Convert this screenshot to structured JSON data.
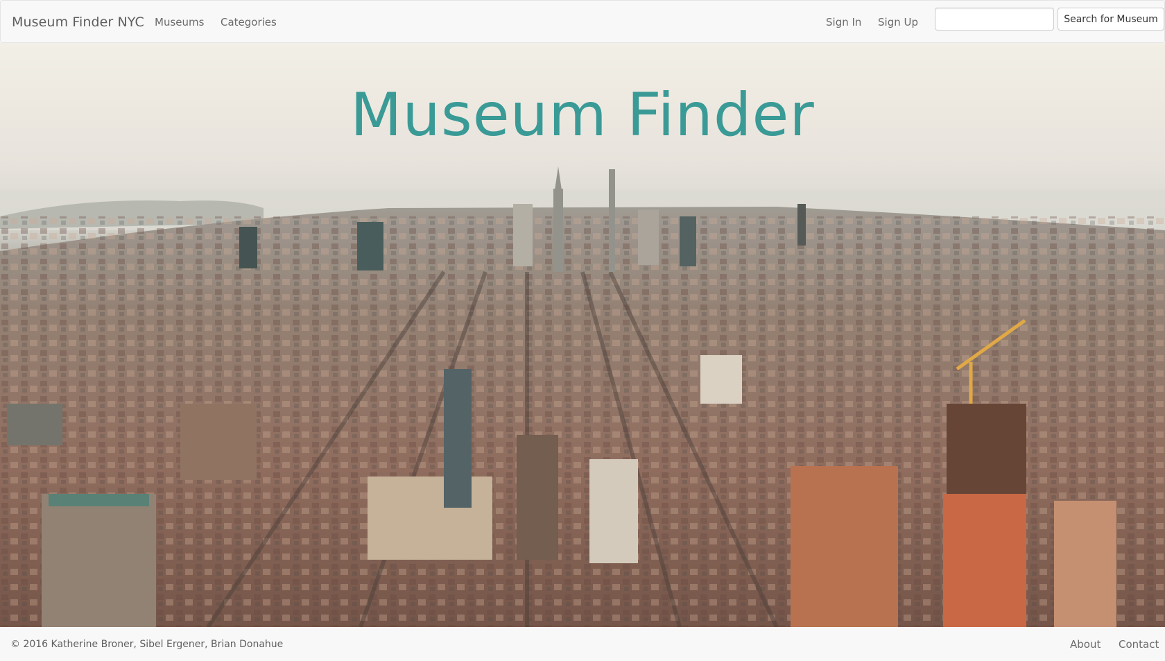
{
  "navbar": {
    "brand": "Museum Finder NYC",
    "links": [
      {
        "label": "Museums"
      },
      {
        "label": "Categories"
      }
    ],
    "auth": {
      "sign_in": "Sign In",
      "sign_up": "Sign Up"
    },
    "search": {
      "value": "",
      "placeholder": "",
      "button_label": "Search for Museum"
    }
  },
  "hero": {
    "title": "Museum Finder",
    "background": "aerial-city-skyline-photo",
    "title_color": "#3a9a96"
  },
  "footer": {
    "copyright": "© 2016 Katherine Broner, Sibel Ergener, Brian Donahue",
    "links": [
      {
        "label": "About"
      },
      {
        "label": "Contact"
      }
    ]
  }
}
